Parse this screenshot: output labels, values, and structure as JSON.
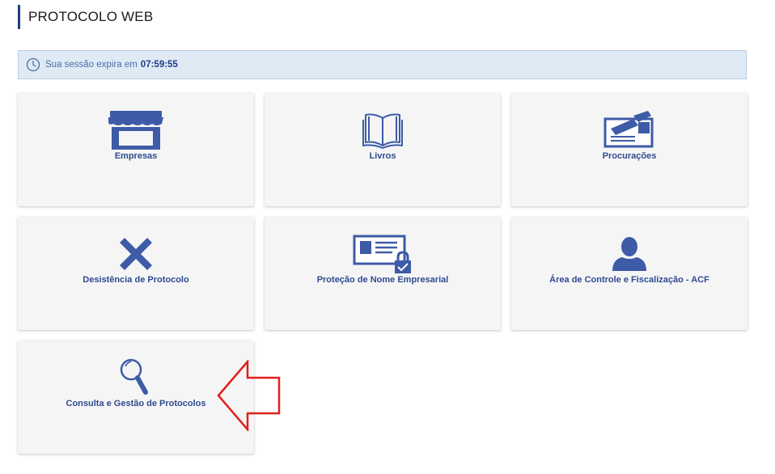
{
  "header": {
    "title": "PROTOCOLO WEB"
  },
  "session": {
    "text": "Sua sessão expira em",
    "time": "07:59:55"
  },
  "cards": [
    {
      "label": "Empresas",
      "icon": "storefront-icon"
    },
    {
      "label": "Livros",
      "icon": "open-book-icon"
    },
    {
      "label": "Procurações",
      "icon": "signed-document-icon"
    },
    {
      "label": "Desistência de Protocolo",
      "icon": "x-mark-icon"
    },
    {
      "label": "Proteção de Nome Empresarial",
      "icon": "locked-id-card-icon"
    },
    {
      "label": "Área de Controle e Fiscalização - ACF",
      "icon": "user-silhouette-icon"
    },
    {
      "label": "Consulta e Gestão de Protocolos",
      "icon": "magnifier-icon"
    }
  ],
  "colors": {
    "accent": "#1f3c88",
    "icon": "#3d5ba6",
    "session_bg": "#dfeaf5",
    "arrow": "#e0201b"
  }
}
